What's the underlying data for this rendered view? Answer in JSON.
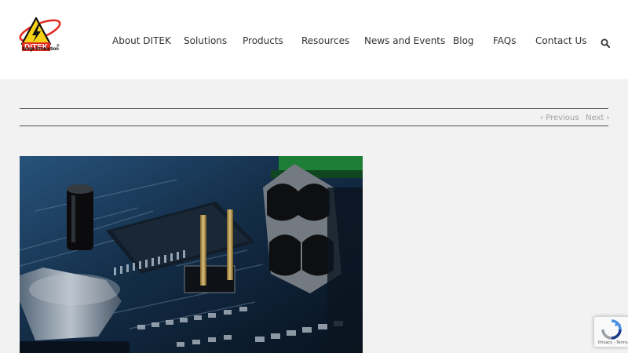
{
  "brand": {
    "logo_text": "DITEK",
    "tagline": "Surge Protection",
    "registered_mark": "®",
    "colors": {
      "red": "#e02b20",
      "yellow": "#f7d116"
    }
  },
  "nav": {
    "items": [
      {
        "label": "About DITEK"
      },
      {
        "label": "Solutions"
      },
      {
        "label": "Products"
      },
      {
        "label": "Resources"
      },
      {
        "label": "News and Events"
      },
      {
        "label": "Blog"
      },
      {
        "label": "FAQs"
      },
      {
        "label": "Contact Us"
      }
    ],
    "search_icon": "search-icon"
  },
  "pagination": {
    "previous_label": "Previous",
    "next_label": "Next"
  },
  "featured_image": {
    "subject": "circuit-board-photo"
  },
  "recaptcha": {
    "footer": "Privacy - Terms"
  }
}
